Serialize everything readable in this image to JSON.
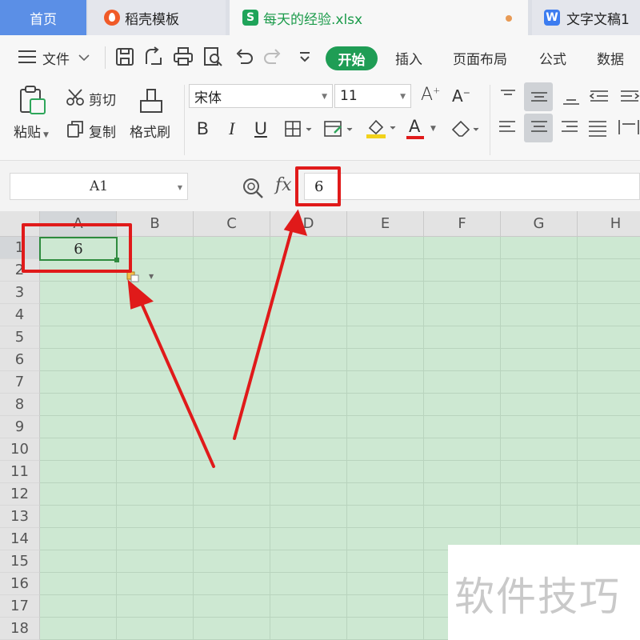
{
  "tabs": [
    {
      "label": "首页"
    },
    {
      "label": "稻壳模板",
      "icon": "daoke-fire-icon"
    },
    {
      "label": "每天的经验.xlsx",
      "icon": "spreadsheet-s-icon",
      "unsaved": true
    },
    {
      "label": "文字文稿1",
      "icon": "writer-w-icon"
    }
  ],
  "toolbar": {
    "file_label": "文件",
    "menu": [
      "开始",
      "插入",
      "页面布局",
      "公式",
      "数据"
    ],
    "active_menu": "开始"
  },
  "ribbon": {
    "paste_label": "粘贴",
    "cut_label": "剪切",
    "copy_label": "复制",
    "format_painter_label": "格式刷",
    "font_name": "宋体",
    "font_size": "11",
    "bold": "B",
    "italic": "I",
    "underline": "U",
    "font_color_glyph": "A",
    "grow_font": "A",
    "shrink_font": "A",
    "colors": {
      "accent": "#1f9d55",
      "highlight_yellow": "#f2d21b",
      "font_red": "#e01a1a"
    }
  },
  "formula_bar": {
    "name_box": "A1",
    "fx": "fx",
    "value": "6"
  },
  "grid": {
    "columns": [
      "A",
      "B",
      "C",
      "D",
      "E",
      "F",
      "G",
      "H"
    ],
    "rows": [
      "1",
      "2",
      "3",
      "4",
      "5",
      "6",
      "7",
      "8",
      "9",
      "10",
      "11",
      "12",
      "13",
      "14",
      "15",
      "16",
      "17",
      "18"
    ],
    "active_cell": "A1",
    "cells": {
      "A1": "6"
    },
    "background": "#cde8d2"
  },
  "annotations": {
    "color": "#e01a1a"
  },
  "watermark": "软件技巧"
}
